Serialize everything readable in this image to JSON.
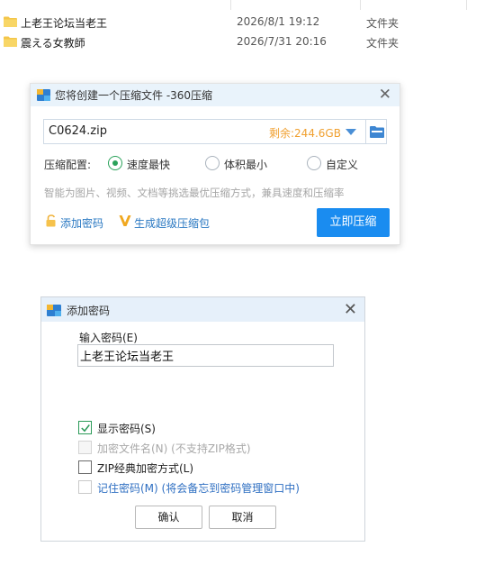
{
  "explorer": {
    "files": [
      {
        "name": "上老王论坛当老王",
        "date": "2026/8/1 19:12",
        "type": "文件夹",
        "icon": "folder-icon"
      },
      {
        "name": "震える女教師",
        "date": "2026/7/31 20:16",
        "type": "文件夹",
        "icon": "folder-icon"
      }
    ]
  },
  "compress_dialog": {
    "title": "您将创建一个压缩文件 -360压缩",
    "path_value": "C0624.zip",
    "free_space": "剩余:244.6GB",
    "config_label": "压缩配置:",
    "options": [
      "速度最快",
      "体积最小",
      "自定义"
    ],
    "selected_option": "速度最快",
    "hint": "智能为图片、视频、文档等挑选最优压缩方式，兼具速度和压缩率",
    "add_password_link": "添加密码",
    "super_compress_link": "生成超级压缩包",
    "compress_now_button": "立即压缩",
    "colors": {
      "accent": "#1a8cf0",
      "free_space": "#f0a030",
      "radio": "#2aa25a",
      "link": "#2a78c2"
    }
  },
  "password_dialog": {
    "title": "添加密码",
    "input_label": "输入密码(E)",
    "password_value": "上老王论坛当老王",
    "checkboxes": [
      {
        "label": "显示密码(S)",
        "checked": true,
        "disabled": false
      },
      {
        "label": "加密文件名(N) (不支持ZIP格式)",
        "checked": false,
        "disabled": true
      },
      {
        "label": "ZIP经典加密方式(L)",
        "checked": false,
        "disabled": false
      },
      {
        "label": "记住密码(M) (将会备忘到密码管理窗口中)",
        "checked": false,
        "disabled": false
      }
    ],
    "ok_button": "确认",
    "cancel_button": "取消"
  }
}
